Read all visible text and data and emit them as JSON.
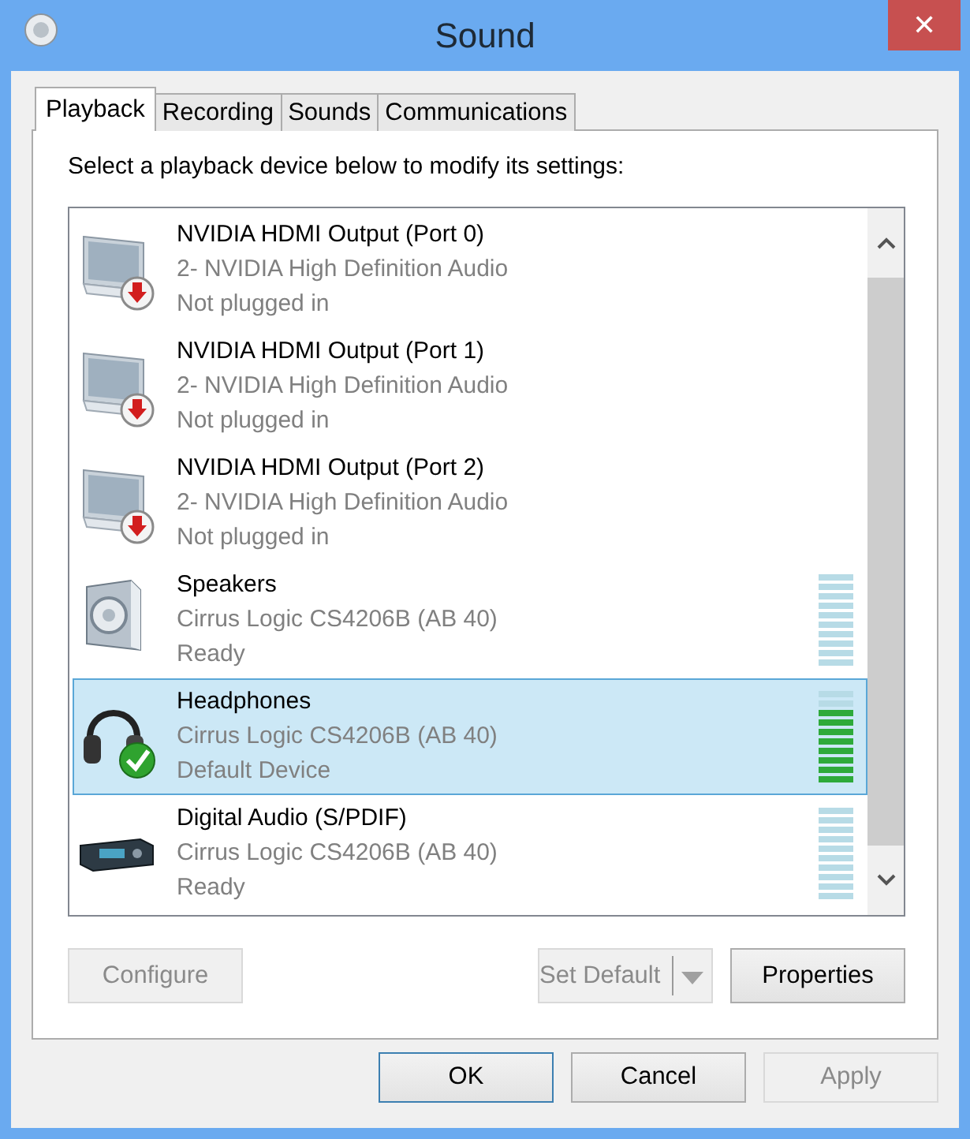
{
  "window": {
    "title": "Sound",
    "close": "✕"
  },
  "tabs": [
    {
      "label": "Playback",
      "selected": true
    },
    {
      "label": "Recording",
      "selected": false
    },
    {
      "label": "Sounds",
      "selected": false
    },
    {
      "label": "Communications",
      "selected": false
    }
  ],
  "instruction": "Select a playback device below to modify its settings:",
  "devices": [
    {
      "kind": "monitor",
      "unplugged": true,
      "default": false,
      "name": "NVIDIA HDMI Output (Port 0)",
      "driver": "2- NVIDIA High Definition Audio",
      "status": "Not plugged in",
      "selected": false
    },
    {
      "kind": "monitor",
      "unplugged": true,
      "default": false,
      "name": "NVIDIA HDMI Output (Port 1)",
      "driver": "2- NVIDIA High Definition Audio",
      "status": "Not plugged in",
      "selected": false
    },
    {
      "kind": "monitor",
      "unplugged": true,
      "default": false,
      "name": "NVIDIA HDMI Output (Port 2)",
      "driver": "2- NVIDIA High Definition Audio",
      "status": "Not plugged in",
      "selected": false
    },
    {
      "kind": "speaker",
      "unplugged": false,
      "default": false,
      "name": "Speakers",
      "driver": "Cirrus Logic CS4206B (AB 40)",
      "status": "Ready",
      "selected": false,
      "level": 0
    },
    {
      "kind": "headphones",
      "unplugged": false,
      "default": true,
      "name": "Headphones",
      "driver": "Cirrus Logic CS4206B (AB 40)",
      "status": "Default Device",
      "selected": true,
      "level": 0.8
    },
    {
      "kind": "receiver",
      "unplugged": false,
      "default": false,
      "name": "Digital Audio (S/PDIF)",
      "driver": "Cirrus Logic CS4206B (AB 40)",
      "status": "Ready",
      "selected": false,
      "level": 0
    }
  ],
  "panel_buttons": [
    {
      "kind": "button",
      "label": "Configure",
      "disabled": true
    },
    {
      "kind": "split",
      "label": "Set Default",
      "disabled": true
    },
    {
      "kind": "button",
      "label": "Properties",
      "disabled": false
    }
  ],
  "dialog_buttons": [
    {
      "label": "OK",
      "disabled": false,
      "default": true
    },
    {
      "label": "Cancel",
      "disabled": false,
      "default": false
    },
    {
      "label": "Apply",
      "disabled": true,
      "default": false
    }
  ]
}
